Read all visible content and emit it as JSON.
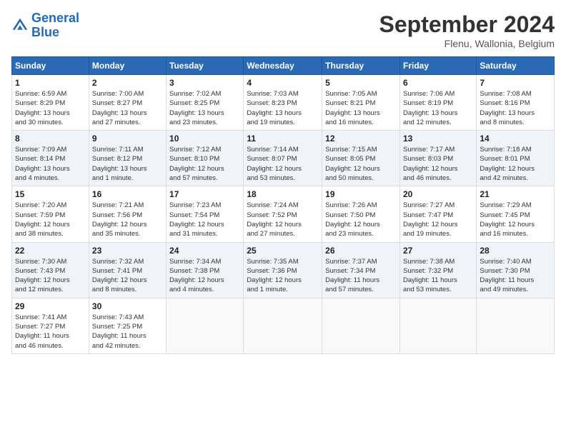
{
  "header": {
    "logo_line1": "General",
    "logo_line2": "Blue",
    "month": "September 2024",
    "location": "Flenu, Wallonia, Belgium"
  },
  "weekdays": [
    "Sunday",
    "Monday",
    "Tuesday",
    "Wednesday",
    "Thursday",
    "Friday",
    "Saturday"
  ],
  "weeks": [
    [
      {
        "day": "1",
        "lines": [
          "Sunrise: 6:59 AM",
          "Sunset: 8:29 PM",
          "Daylight: 13 hours",
          "and 30 minutes."
        ]
      },
      {
        "day": "2",
        "lines": [
          "Sunrise: 7:00 AM",
          "Sunset: 8:27 PM",
          "Daylight: 13 hours",
          "and 27 minutes."
        ]
      },
      {
        "day": "3",
        "lines": [
          "Sunrise: 7:02 AM",
          "Sunset: 8:25 PM",
          "Daylight: 13 hours",
          "and 23 minutes."
        ]
      },
      {
        "day": "4",
        "lines": [
          "Sunrise: 7:03 AM",
          "Sunset: 8:23 PM",
          "Daylight: 13 hours",
          "and 19 minutes."
        ]
      },
      {
        "day": "5",
        "lines": [
          "Sunrise: 7:05 AM",
          "Sunset: 8:21 PM",
          "Daylight: 13 hours",
          "and 16 minutes."
        ]
      },
      {
        "day": "6",
        "lines": [
          "Sunrise: 7:06 AM",
          "Sunset: 8:19 PM",
          "Daylight: 13 hours",
          "and 12 minutes."
        ]
      },
      {
        "day": "7",
        "lines": [
          "Sunrise: 7:08 AM",
          "Sunset: 8:16 PM",
          "Daylight: 13 hours",
          "and 8 minutes."
        ]
      }
    ],
    [
      {
        "day": "8",
        "lines": [
          "Sunrise: 7:09 AM",
          "Sunset: 8:14 PM",
          "Daylight: 13 hours",
          "and 4 minutes."
        ]
      },
      {
        "day": "9",
        "lines": [
          "Sunrise: 7:11 AM",
          "Sunset: 8:12 PM",
          "Daylight: 13 hours",
          "and 1 minute."
        ]
      },
      {
        "day": "10",
        "lines": [
          "Sunrise: 7:12 AM",
          "Sunset: 8:10 PM",
          "Daylight: 12 hours",
          "and 57 minutes."
        ]
      },
      {
        "day": "11",
        "lines": [
          "Sunrise: 7:14 AM",
          "Sunset: 8:07 PM",
          "Daylight: 12 hours",
          "and 53 minutes."
        ]
      },
      {
        "day": "12",
        "lines": [
          "Sunrise: 7:15 AM",
          "Sunset: 8:05 PM",
          "Daylight: 12 hours",
          "and 50 minutes."
        ]
      },
      {
        "day": "13",
        "lines": [
          "Sunrise: 7:17 AM",
          "Sunset: 8:03 PM",
          "Daylight: 12 hours",
          "and 46 minutes."
        ]
      },
      {
        "day": "14",
        "lines": [
          "Sunrise: 7:18 AM",
          "Sunset: 8:01 PM",
          "Daylight: 12 hours",
          "and 42 minutes."
        ]
      }
    ],
    [
      {
        "day": "15",
        "lines": [
          "Sunrise: 7:20 AM",
          "Sunset: 7:59 PM",
          "Daylight: 12 hours",
          "and 38 minutes."
        ]
      },
      {
        "day": "16",
        "lines": [
          "Sunrise: 7:21 AM",
          "Sunset: 7:56 PM",
          "Daylight: 12 hours",
          "and 35 minutes."
        ]
      },
      {
        "day": "17",
        "lines": [
          "Sunrise: 7:23 AM",
          "Sunset: 7:54 PM",
          "Daylight: 12 hours",
          "and 31 minutes."
        ]
      },
      {
        "day": "18",
        "lines": [
          "Sunrise: 7:24 AM",
          "Sunset: 7:52 PM",
          "Daylight: 12 hours",
          "and 27 minutes."
        ]
      },
      {
        "day": "19",
        "lines": [
          "Sunrise: 7:26 AM",
          "Sunset: 7:50 PM",
          "Daylight: 12 hours",
          "and 23 minutes."
        ]
      },
      {
        "day": "20",
        "lines": [
          "Sunrise: 7:27 AM",
          "Sunset: 7:47 PM",
          "Daylight: 12 hours",
          "and 19 minutes."
        ]
      },
      {
        "day": "21",
        "lines": [
          "Sunrise: 7:29 AM",
          "Sunset: 7:45 PM",
          "Daylight: 12 hours",
          "and 16 minutes."
        ]
      }
    ],
    [
      {
        "day": "22",
        "lines": [
          "Sunrise: 7:30 AM",
          "Sunset: 7:43 PM",
          "Daylight: 12 hours",
          "and 12 minutes."
        ]
      },
      {
        "day": "23",
        "lines": [
          "Sunrise: 7:32 AM",
          "Sunset: 7:41 PM",
          "Daylight: 12 hours",
          "and 8 minutes."
        ]
      },
      {
        "day": "24",
        "lines": [
          "Sunrise: 7:34 AM",
          "Sunset: 7:38 PM",
          "Daylight: 12 hours",
          "and 4 minutes."
        ]
      },
      {
        "day": "25",
        "lines": [
          "Sunrise: 7:35 AM",
          "Sunset: 7:36 PM",
          "Daylight: 12 hours",
          "and 1 minute."
        ]
      },
      {
        "day": "26",
        "lines": [
          "Sunrise: 7:37 AM",
          "Sunset: 7:34 PM",
          "Daylight: 11 hours",
          "and 57 minutes."
        ]
      },
      {
        "day": "27",
        "lines": [
          "Sunrise: 7:38 AM",
          "Sunset: 7:32 PM",
          "Daylight: 11 hours",
          "and 53 minutes."
        ]
      },
      {
        "day": "28",
        "lines": [
          "Sunrise: 7:40 AM",
          "Sunset: 7:30 PM",
          "Daylight: 11 hours",
          "and 49 minutes."
        ]
      }
    ],
    [
      {
        "day": "29",
        "lines": [
          "Sunrise: 7:41 AM",
          "Sunset: 7:27 PM",
          "Daylight: 11 hours",
          "and 46 minutes."
        ]
      },
      {
        "day": "30",
        "lines": [
          "Sunrise: 7:43 AM",
          "Sunset: 7:25 PM",
          "Daylight: 11 hours",
          "and 42 minutes."
        ]
      },
      null,
      null,
      null,
      null,
      null
    ]
  ]
}
